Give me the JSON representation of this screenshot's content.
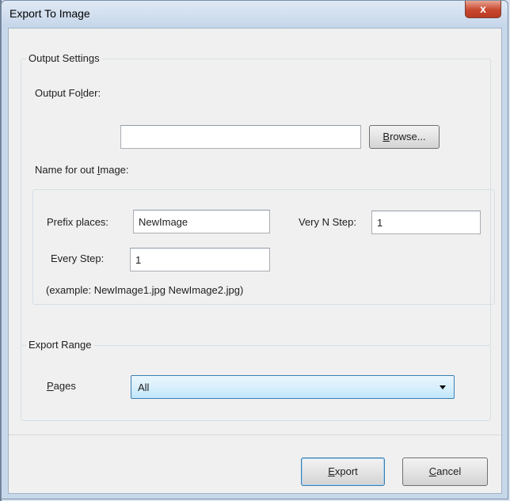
{
  "window": {
    "title": "Export To Image",
    "close_glyph": "x"
  },
  "output_settings": {
    "legend": "Output Settings",
    "folder_label_pre": "Output Fo",
    "folder_label_accel": "l",
    "folder_label_post": "der:",
    "folder_value": "",
    "browse_accel": "B",
    "browse_rest": "rowse...",
    "name_label_pre": "Name for out ",
    "name_label_accel": "I",
    "name_label_post": "mage:",
    "prefix_label": "Prefix places:",
    "prefix_value": "NewImage",
    "very_n_label": "Very N Step:",
    "very_n_value": "1",
    "every_step_label": "Every Step:",
    "every_step_value": "1",
    "example": "(example: NewImage1.jpg NewImage2.jpg)"
  },
  "export_range": {
    "legend": "Export Range",
    "pages_accel": "P",
    "pages_rest": "ages",
    "pages_selected": "All"
  },
  "footer": {
    "export_accel": "E",
    "export_rest": "xport",
    "cancel_accel": "C",
    "cancel_rest": "ancel"
  }
}
